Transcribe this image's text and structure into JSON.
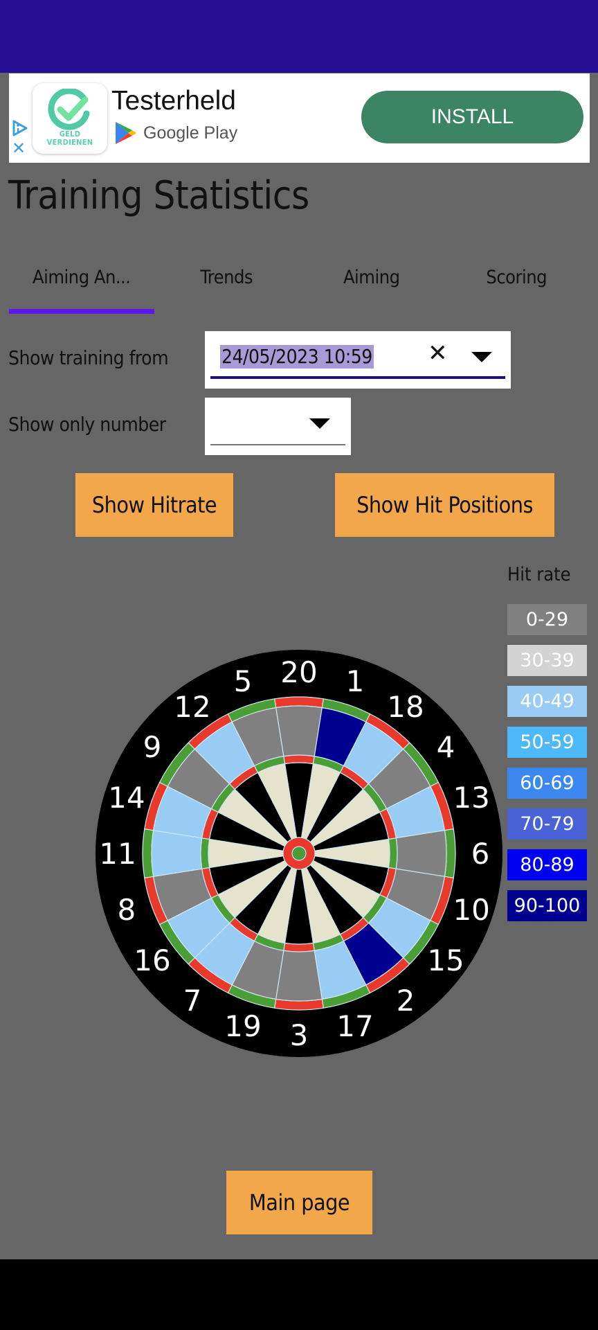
{
  "ad": {
    "app_name": "Testerheld",
    "icon_text_line1": "GELD",
    "icon_text_line2": "VERDIENEN",
    "store_label": "Google Play",
    "install_label": "INSTALL",
    "close_glyph": "✕"
  },
  "page": {
    "title": "Training Statistics"
  },
  "tabs": [
    {
      "label": "Aiming An...",
      "active": true
    },
    {
      "label": "Trends",
      "active": false
    },
    {
      "label": "Aiming",
      "active": false
    },
    {
      "label": "Scoring",
      "active": false
    }
  ],
  "filters": {
    "training_from_label": "Show training from",
    "training_from_value": "24/05/2023 10:59",
    "clear_glyph": "✕",
    "only_number_label": "Show only number",
    "only_number_value": ""
  },
  "buttons": {
    "show_hitrate": "Show Hitrate",
    "show_hit_positions": "Show Hit Positions",
    "main_page": "Main page"
  },
  "legend": {
    "title": "Hit rate",
    "items": [
      {
        "label": "0-29",
        "color": "#808080"
      },
      {
        "label": "30-39",
        "color": "#d3d3d3"
      },
      {
        "label": "40-49",
        "color": "#99ccf5"
      },
      {
        "label": "50-59",
        "color": "#4db8fa"
      },
      {
        "label": "60-69",
        "color": "#3d88f0"
      },
      {
        "label": "70-79",
        "color": "#4a62d8"
      },
      {
        "label": "80-89",
        "color": "#0000f0"
      },
      {
        "label": "90-100",
        "color": "#000090"
      }
    ]
  },
  "dartboard": {
    "numbers": [
      20,
      1,
      18,
      4,
      13,
      6,
      10,
      15,
      2,
      17,
      3,
      19,
      7,
      16,
      8,
      11,
      14,
      9,
      12,
      5
    ],
    "hit_rate_band": {
      "20": "0-29",
      "1": "90-100",
      "18": "40-49",
      "4": "0-29",
      "13": "40-49",
      "6": "0-29",
      "10": "0-29",
      "15": "40-49",
      "2": "90-100",
      "17": "40-49",
      "3": "0-29",
      "19": "0-29",
      "7": "40-49",
      "16": "40-49",
      "8": "0-29",
      "11": "40-49",
      "14": "40-49",
      "9": "0-29",
      "12": "40-49",
      "5": "0-29"
    },
    "colors": {
      "surround": "#000000",
      "ring_red": "#e8392b",
      "ring_green": "#4a9e35",
      "inner_light": "#e6e3cc",
      "inner_dark": "#000000",
      "wire": "#cde8f5",
      "number_text": "#ffffff"
    }
  }
}
